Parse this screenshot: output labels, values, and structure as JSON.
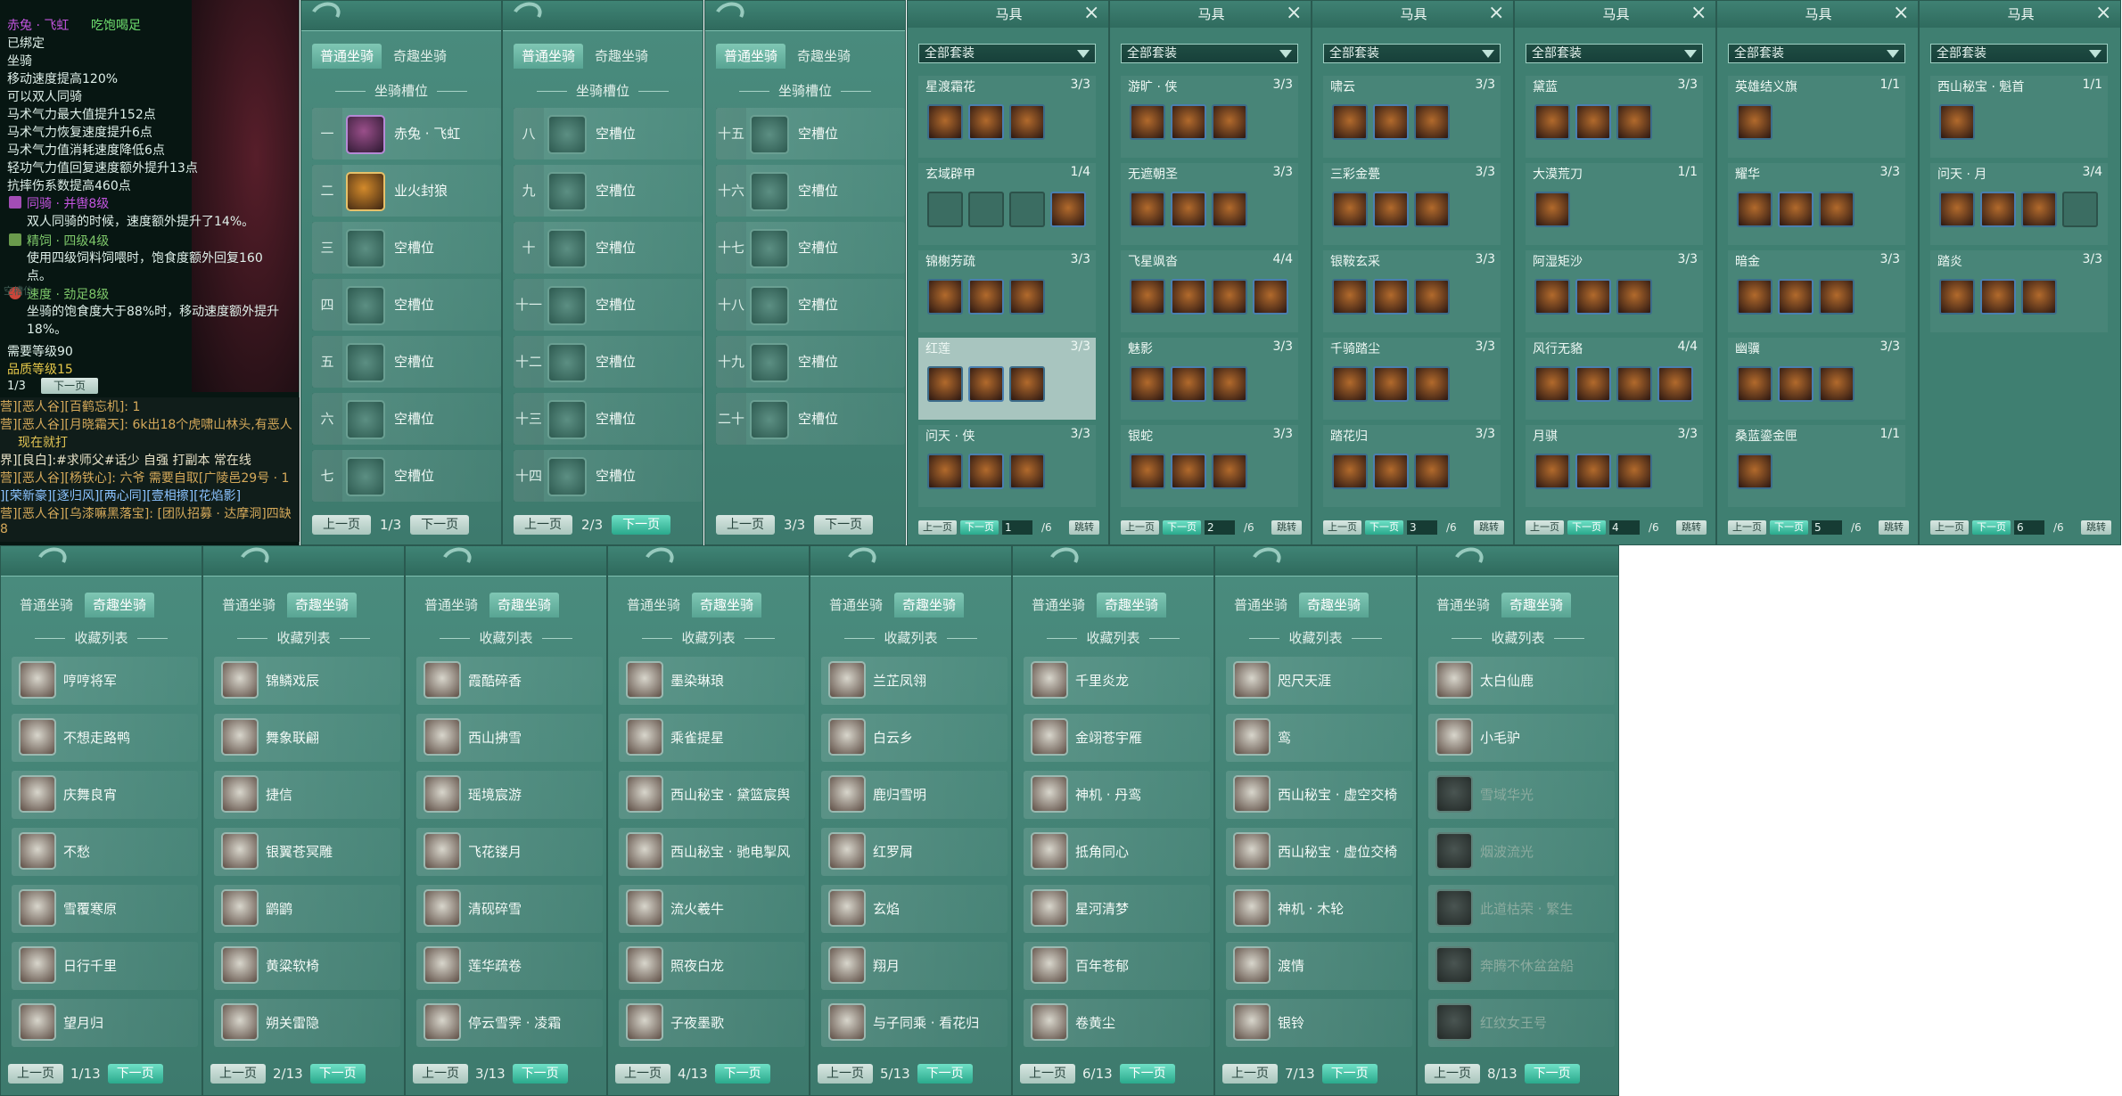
{
  "tooltip": {
    "title": "赤兔 · 飞虹",
    "status": "吃饱喝足",
    "bound": "已绑定",
    "type": "坐骑",
    "stats": [
      "移动速度提高120%",
      "可以双人同骑",
      "马术气力最大值提升152点",
      "马术气力恢复速度提升6点",
      "马术气力值消耗速度降低6点",
      "轻功气力值回复速度额外提升13点",
      "抗摔伤系数提高460点"
    ],
    "skills": [
      {
        "name": "同骑 · 并辔8级",
        "desc": "双人同骑的时候，速度额外提升了14%。"
      },
      {
        "name": "精饲 · 四级4级",
        "desc": "使用四级饲料饲喂时，饱食度额外回复160点。"
      },
      {
        "name": "速度 · 劲足8级",
        "desc": "坐骑的饱食度大于88%时，移动速度额外提升18%。"
      }
    ],
    "req_level": "需要等级90",
    "quality": "品质等级15",
    "page": "1/3",
    "next": "下一页",
    "faded": "空槽位"
  },
  "chat": [
    {
      "text": "营][恶人谷][百鹤忘机]: 1",
      "color": "#d5a95a"
    },
    {
      "text": "营][恶人谷][月晓霜天]: 6k出18个虎啸山林头,有恶人",
      "color": "#d5a95a"
    },
    {
      "text": "现在就打",
      "color": "#e2c454"
    },
    {
      "text": "界][良白]:#求师父#话少  自强  打副本  常在线",
      "color": "#e8e2c8"
    },
    {
      "text": "营][恶人谷][杨铁心]: 六爷 需要自取[广陵邑29号 · 1",
      "color": "#d5a95a"
    },
    {
      "text": "][荣新豪][逐归风][两心同][壹相擦][花焰影]",
      "color": "#8bc3ff"
    },
    {
      "text": "营][恶人谷][乌漆嘛黑落宝]: [团队招募 · 达摩洞]四缺",
      "color": "#d5a95a"
    },
    {
      "text": "8",
      "color": "#d5a95a"
    }
  ],
  "mount_tabs": {
    "normal": "普通坐骑",
    "fancy": "奇趣坐骑"
  },
  "slot_title": "坐骑槽位",
  "slot_panels": [
    {
      "rows": [
        {
          "num": "一",
          "name": "赤兔 · 飞虹",
          "kind": "fill1"
        },
        {
          "num": "二",
          "name": "业火封狼",
          "kind": "fill2"
        },
        {
          "num": "三",
          "name": "空槽位",
          "kind": ""
        },
        {
          "num": "四",
          "name": "空槽位",
          "kind": ""
        },
        {
          "num": "五",
          "name": "空槽位",
          "kind": ""
        },
        {
          "num": "六",
          "name": "空槽位",
          "kind": ""
        },
        {
          "num": "七",
          "name": "空槽位",
          "kind": ""
        }
      ],
      "page": "1/3"
    },
    {
      "rows": [
        {
          "num": "八",
          "name": "空槽位",
          "kind": ""
        },
        {
          "num": "九",
          "name": "空槽位",
          "kind": ""
        },
        {
          "num": "十",
          "name": "空槽位",
          "kind": ""
        },
        {
          "num": "十一",
          "name": "空槽位",
          "kind": ""
        },
        {
          "num": "十二",
          "name": "空槽位",
          "kind": ""
        },
        {
          "num": "十三",
          "name": "空槽位",
          "kind": ""
        },
        {
          "num": "十四",
          "name": "空槽位",
          "kind": ""
        }
      ],
      "page": "2/3"
    },
    {
      "rows": [
        {
          "num": "十五",
          "name": "空槽位",
          "kind": ""
        },
        {
          "num": "十六",
          "name": "空槽位",
          "kind": ""
        },
        {
          "num": "十七",
          "name": "空槽位",
          "kind": ""
        },
        {
          "num": "十八",
          "name": "空槽位",
          "kind": ""
        },
        {
          "num": "十九",
          "name": "空槽位",
          "kind": ""
        },
        {
          "num": "二十",
          "name": "空槽位",
          "kind": ""
        }
      ],
      "page": "3/3"
    }
  ],
  "pager": {
    "prev": "上一页",
    "next": "下一页",
    "jump": "跳转",
    "total": "/6"
  },
  "equip": {
    "title": "马具",
    "filter": "全部套装",
    "panels": [
      {
        "sets": [
          {
            "name": "星渡霜花",
            "count": "3/3",
            "icons": 3,
            "empty": 0
          },
          {
            "name": "玄域辟甲",
            "count": "1/4",
            "icons": 1,
            "empty": 3
          },
          {
            "name": "锦榭芳疏",
            "count": "3/3",
            "icons": 3,
            "empty": 0
          },
          {
            "name": "红莲",
            "count": "3/3",
            "icons": 3,
            "empty": 0,
            "hl": true
          },
          {
            "name": "问天 · 侠",
            "count": "3/3",
            "icons": 3,
            "empty": 0
          }
        ],
        "page": "1"
      },
      {
        "sets": [
          {
            "name": "游旷 · 侠",
            "count": "3/3",
            "icons": 3,
            "empty": 0
          },
          {
            "name": "无遮朝圣",
            "count": "3/3",
            "icons": 3,
            "empty": 0
          },
          {
            "name": "飞星飒沓",
            "count": "4/4",
            "icons": 4,
            "empty": 0
          },
          {
            "name": "魅影",
            "count": "3/3",
            "icons": 3,
            "empty": 0
          },
          {
            "name": "银蛇",
            "count": "3/3",
            "icons": 3,
            "empty": 0
          }
        ],
        "page": "2"
      },
      {
        "sets": [
          {
            "name": "啸云",
            "count": "3/3",
            "icons": 3,
            "empty": 0
          },
          {
            "name": "三彩金甍",
            "count": "3/3",
            "icons": 3,
            "empty": 0
          },
          {
            "name": "银鞍玄采",
            "count": "3/3",
            "icons": 3,
            "empty": 0
          },
          {
            "name": "千骑踏尘",
            "count": "3/3",
            "icons": 3,
            "empty": 0
          },
          {
            "name": "踏花归",
            "count": "3/3",
            "icons": 3,
            "empty": 0
          }
        ],
        "page": "3"
      },
      {
        "sets": [
          {
            "name": "黛蓝",
            "count": "3/3",
            "icons": 3,
            "empty": 0
          },
          {
            "name": "大漠荒刀",
            "count": "1/1",
            "icons": 1,
            "empty": 0
          },
          {
            "name": "阿湿矩沙",
            "count": "3/3",
            "icons": 3,
            "empty": 0
          },
          {
            "name": "风行无貉",
            "count": "4/4",
            "icons": 4,
            "empty": 0
          },
          {
            "name": "月骐",
            "count": "3/3",
            "icons": 3,
            "empty": 0
          }
        ],
        "page": "4"
      },
      {
        "sets": [
          {
            "name": "英雄结义旗",
            "count": "1/1",
            "icons": 1,
            "empty": 0
          },
          {
            "name": "耀华",
            "count": "3/3",
            "icons": 3,
            "empty": 0
          },
          {
            "name": "暗金",
            "count": "3/3",
            "icons": 3,
            "empty": 0
          },
          {
            "name": "幽骥",
            "count": "3/3",
            "icons": 3,
            "empty": 0
          },
          {
            "name": "桑蓝鎏金匣",
            "count": "1/1",
            "icons": 1,
            "empty": 0
          }
        ],
        "page": "5"
      },
      {
        "sets": [
          {
            "name": "西山秘宝 · 魁首",
            "count": "1/1",
            "icons": 1,
            "empty": 0
          },
          {
            "name": "问天 · 月",
            "count": "3/4",
            "icons": 3,
            "empty": 1
          },
          {
            "name": "踏炎",
            "count": "3/3",
            "icons": 3,
            "empty": 0
          }
        ],
        "page": "6"
      }
    ]
  },
  "collect_title": "收藏列表",
  "collect_panels": [
    {
      "items": [
        "哼哼将军",
        "不想走路鸭",
        "庆舞良宵",
        "不愁",
        "雪覆寒原",
        "日行千里",
        "望月归"
      ],
      "page": "1/13",
      "dim": []
    },
    {
      "items": [
        "锦鳞戏辰",
        "舞象联翩",
        "捷信",
        "银翼苍冥雕",
        "鹠鹠",
        "黄粱软椅",
        "朔关雷隐"
      ],
      "page": "2/13",
      "dim": []
    },
    {
      "items": [
        "霞酷碎香",
        "西山拂雪",
        "瑶境宸游",
        "飞花镂月",
        "清砚碎雪",
        "莲华疏卷",
        "停云雪霁 · 凌霜"
      ],
      "page": "3/13",
      "dim": []
    },
    {
      "items": [
        "墨染琳琅",
        "乘雀提星",
        "西山秘宝 · 黛篮宸舆",
        "西山秘宝 · 驰电掣风",
        "流火羲牛",
        "照夜白龙",
        "子夜墨歌"
      ],
      "page": "4/13",
      "dim": []
    },
    {
      "items": [
        "兰芷凤翎",
        "白云乡",
        "鹿归雪明",
        "红罗屑",
        "玄焰",
        "翔月",
        "与子同乘 · 看花归"
      ],
      "page": "5/13",
      "dim": []
    },
    {
      "items": [
        "千里炎龙",
        "金翊苍宇雁",
        "神机 · 丹鸾",
        "抵角同心",
        "星河清梦",
        "百年苍郁",
        "卷黄尘"
      ],
      "page": "6/13",
      "dim": []
    },
    {
      "items": [
        "咫尺天涯",
        "鸾",
        "西山秘宝 · 虚空交椅",
        "西山秘宝 · 虚位交椅",
        "神机 · 木轮",
        "渡情",
        "银铃"
      ],
      "page": "7/13",
      "dim": []
    },
    {
      "items": [
        "太白仙鹿",
        "小毛驴",
        "雪域华光",
        "烟波流光",
        "此道枯荣 · 繁生",
        "奔腾不休盆盆船",
        "红纹女王号"
      ],
      "page": "8/13",
      "dim": [
        2,
        3,
        4,
        5,
        6
      ]
    }
  ]
}
